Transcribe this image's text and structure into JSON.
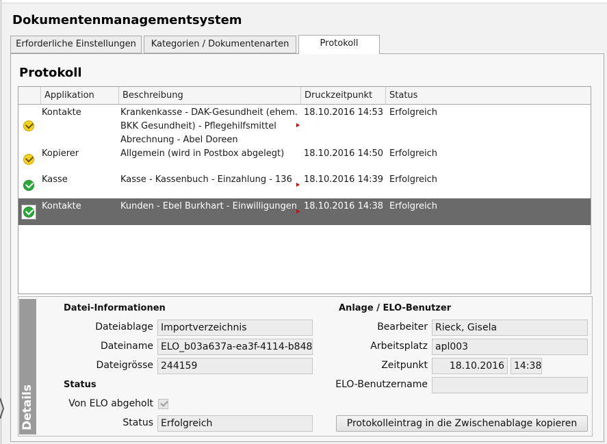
{
  "window": {
    "title": "Dokumentenmanagementsystem"
  },
  "tabs": [
    {
      "label": "Erforderliche Einstellungen",
      "active": false
    },
    {
      "label": "Kategorien / Dokumentenarten",
      "active": false
    },
    {
      "label": "Protokoll",
      "active": true
    }
  ],
  "section": {
    "title": "Protokoll"
  },
  "grid": {
    "columns": [
      "Applikation",
      "Beschreibung",
      "Druckzeitpunkt",
      "Status"
    ],
    "rows": [
      {
        "status_icon": "warning-check-icon",
        "app": "Kontakte",
        "desc_lines": [
          "Krankenkasse - DAK-Gesundheit (ehem.",
          "BKK Gesundheit) - Pflegehilfsmittel",
          "Abrechnung - Abel Doreen"
        ],
        "time": "18.10.2016 14:53",
        "status": "Erfolgreich"
      },
      {
        "status_icon": "warning-check-icon",
        "app": "Kopierer",
        "desc_lines": [
          "Allgemein (wird in Postbox abgelegt)"
        ],
        "time": "18.10.2016 14:50",
        "status": "Erfolgreich"
      },
      {
        "status_icon": "success-check-icon",
        "app": "Kasse",
        "desc_lines": [
          "Kasse - Kassenbuch - Einzahlung - 136"
        ],
        "time": "18.10.2016 14:39",
        "status": "Erfolgreich"
      },
      {
        "status_icon": "success-check-icon",
        "app": "Kontakte",
        "desc_lines": [
          "Kunden - Ebel Burkhart - Einwilligungen"
        ],
        "time": "18.10.2016 14:38",
        "status": "Erfolgreich",
        "selected": true
      }
    ]
  },
  "details": {
    "tab_label": "Details",
    "file_info": {
      "heading": "Datei-Informationen",
      "storage_label": "Dateiablage",
      "storage_value": "Importverzeichnis",
      "name_label": "Dateiname",
      "name_value": "ELO_b03a637a-ea3f-4114-b848",
      "size_label": "Dateigrösse",
      "size_value": "244159"
    },
    "status": {
      "heading": "Status",
      "fetched_label": "Von ELO abgeholt",
      "fetched_checked": true,
      "status_label": "Status",
      "status_value": "Erfolgreich"
    },
    "user": {
      "heading": "Anlage / ELO-Benutzer",
      "editor_label": "Bearbeiter",
      "editor_value": "Rieck, Gisela",
      "workstation_label": "Arbeitsplatz",
      "workstation_value": "apl003",
      "time_label": "Zeitpunkt",
      "date_value": "18.10.2016",
      "clock_value": "14:38",
      "elo_user_label": "ELO-Benutzername",
      "elo_user_value": ""
    },
    "copy_button": "Protokolleintrag in die Zwischenablage kopieren"
  },
  "colors": {
    "selected_row": "#6a6a6a",
    "success": "#2ca83a",
    "warning": "#f2d21a",
    "truncate_marker": "#e00000"
  }
}
